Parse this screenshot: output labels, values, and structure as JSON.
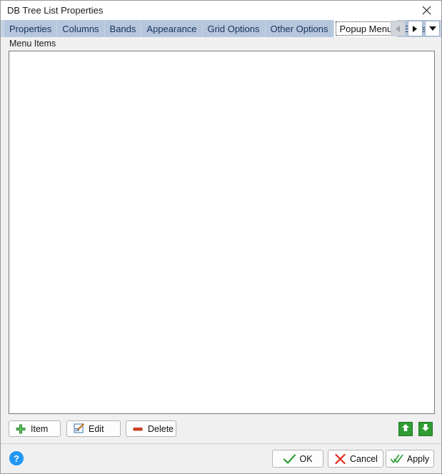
{
  "window": {
    "title": "DB Tree List Properties",
    "close_icon": "close-icon"
  },
  "tabs": {
    "items": [
      {
        "label": "Properties",
        "selected": false
      },
      {
        "label": "Columns",
        "selected": false
      },
      {
        "label": "Bands",
        "selected": false
      },
      {
        "label": "Appearance",
        "selected": false
      },
      {
        "label": "Grid Options",
        "selected": false
      },
      {
        "label": "Other Options",
        "selected": false
      },
      {
        "label": "Popup Menu",
        "selected": true
      },
      {
        "label": "EEPs",
        "selected": false
      }
    ],
    "selected_label": "Popup Menu",
    "nav": {
      "prev_icon": "triangle-left-icon",
      "prev_enabled": false,
      "next_icon": "triangle-right-icon",
      "next_enabled": true,
      "dropdown_icon": "chevron-down-icon"
    }
  },
  "main": {
    "group_label": "Menu Items",
    "list_items": []
  },
  "itembar": {
    "item_label": "Item",
    "item_icon": "plus-icon",
    "edit_label": "Edit",
    "edit_icon": "pencil-icon",
    "delete_label": "Delete",
    "delete_icon": "minus-icon",
    "move_up_icon": "arrow-up-icon",
    "move_down_icon": "arrow-down-icon"
  },
  "footer": {
    "help_label": "?",
    "help_icon": "question-mark-icon",
    "ok_label": "OK",
    "ok_icon": "check-icon",
    "cancel_label": "Cancel",
    "cancel_icon": "x-icon",
    "apply_label": "Apply",
    "apply_icon": "double-check-icon"
  },
  "colors": {
    "tabstrip": "#c5d3e6",
    "tab": "#b6c7dd",
    "tab_text": "#16325c",
    "dialog_bg": "#f0f0f0",
    "green": "#2f9c34",
    "red": "#d93025",
    "blue": "#2196f3"
  }
}
